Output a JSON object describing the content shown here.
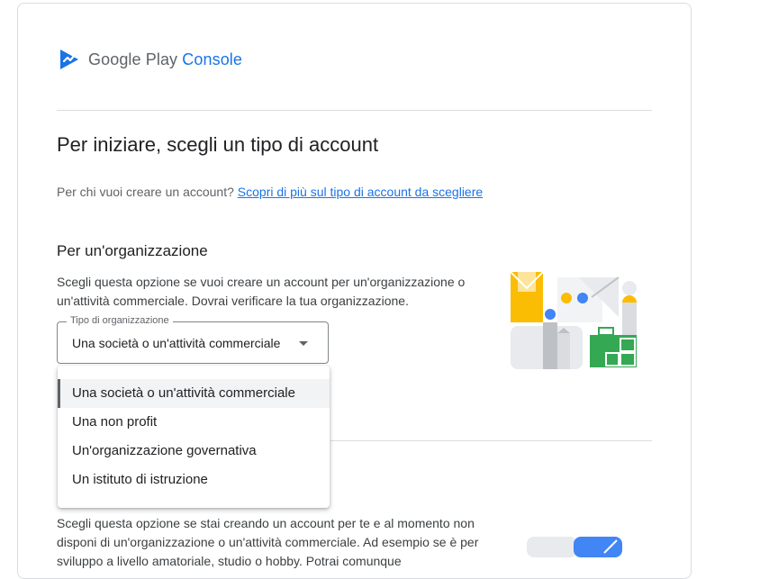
{
  "brand": {
    "name_prefix": "Google Play",
    "name_suffix": "Console",
    "accent_color": "#1a73e8"
  },
  "page": {
    "title": "Per iniziare, scegli un tipo di account",
    "subtitle_text": "Per chi vuoi creare un account?",
    "subtitle_link": "Scopri di più sul tipo di account da scegliere"
  },
  "organization": {
    "title": "Per un'organizzazione",
    "description": "Scegli questa opzione se vuoi creare un account per un'organizzazione o un'attività commerciale. Dovrai verificare la tua organizzazione.",
    "select_label": "Tipo di organizzazione",
    "select_value": "Una società o un'attività commerciale",
    "options": [
      "Una società o un'attività commerciale",
      "Una non profit",
      "Un'organizzazione governativa",
      "Un istituto di istruzione"
    ]
  },
  "personal": {
    "description": "Scegli questa opzione se stai creando un account per te e al momento non disponi di un'organizzazione o un'attività commerciale. Ad esempio se è per sviluppo a livello amatoriale, studio o hobby. Potrai comunque"
  }
}
